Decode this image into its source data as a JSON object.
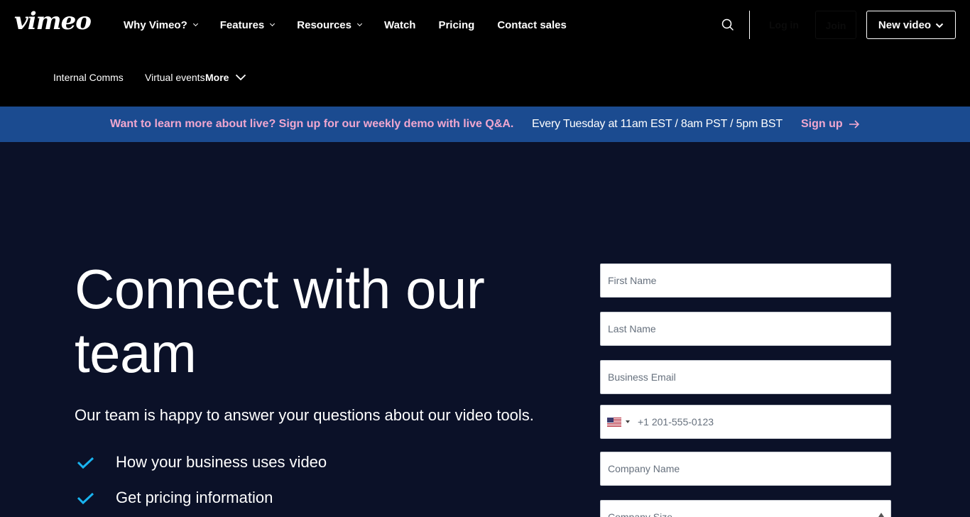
{
  "header": {
    "logo": "vimeo",
    "nav": [
      {
        "label": "Why Vimeo?",
        "dropdown": true
      },
      {
        "label": "Features",
        "dropdown": true
      },
      {
        "label": "Resources",
        "dropdown": true
      },
      {
        "label": "Watch",
        "dropdown": false
      },
      {
        "label": "Pricing",
        "dropdown": false
      },
      {
        "label": "Contact sales",
        "dropdown": false
      }
    ],
    "login_label": "Log in",
    "join_label": "Join",
    "new_video_label": "New video"
  },
  "subnav": {
    "links": [
      "Internal Comms",
      "Virtual events"
    ],
    "more_label": "More"
  },
  "banner": {
    "promo": "Want to learn more about live? Sign up for our weekly demo with live Q&A.",
    "schedule": "Every Tuesday at 11am EST / 8am PST / 5pm BST",
    "signup_label": "Sign up"
  },
  "hero": {
    "title": "Connect with our team",
    "subtitle": "Our team is happy to answer your questions about our video tools.",
    "bullets": [
      "How your business uses video",
      "Get pricing information"
    ]
  },
  "form": {
    "first_name_placeholder": "First Name",
    "last_name_placeholder": "Last Name",
    "email_placeholder": "Business Email",
    "phone_placeholder": "+1 201-555-0123",
    "phone_country": "US",
    "company_name_placeholder": "Company Name",
    "company_size_label": "Company Size"
  },
  "colors": {
    "page_bg": "#0b1128",
    "header_bg": "#000000",
    "banner_bg": "#1b4b90",
    "banner_accent": "#f0a7cf",
    "check_color": "#19b4f0"
  },
  "icons": [
    "search-icon",
    "chevron-down-icon",
    "arrow-right-icon",
    "check-icon",
    "us-flag-icon"
  ]
}
